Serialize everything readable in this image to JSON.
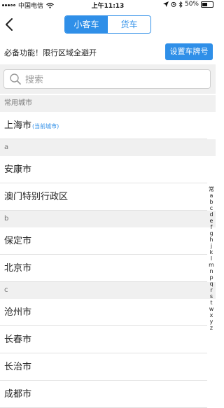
{
  "status": {
    "carrier": "中国电信",
    "time": "上午11:13",
    "battery": "50%",
    "battery_level": 0.5
  },
  "nav": {
    "tabs": [
      "小客车",
      "货车"
    ],
    "active_tab": 0
  },
  "promo": {
    "text": "必备功能！限行区域全避开",
    "button": "设置车牌号"
  },
  "search": {
    "placeholder": "搜索",
    "value": ""
  },
  "sections": [
    {
      "header": "常用城市",
      "cities": [
        {
          "name": "上海市",
          "tag": "(当前城市)"
        }
      ]
    },
    {
      "header": "a",
      "cities": [
        {
          "name": "安康市"
        },
        {
          "name": "澳门特别行政区"
        }
      ]
    },
    {
      "header": "b",
      "cities": [
        {
          "name": "保定市"
        },
        {
          "name": "北京市"
        }
      ]
    },
    {
      "header": "c",
      "cities": [
        {
          "name": "沧州市"
        },
        {
          "name": "长春市"
        },
        {
          "name": "长治市"
        },
        {
          "name": "成都市"
        }
      ]
    }
  ],
  "index": [
    "常",
    "a",
    "b",
    "c",
    "d",
    "e",
    "f",
    "g",
    "h",
    "j",
    "k",
    "l",
    "m",
    "n",
    "p",
    "q",
    "r",
    "s",
    "t",
    "w",
    "x",
    "y",
    "z"
  ],
  "colors": {
    "accent": "#2f8fe8",
    "section_bg": "#f0f0f0"
  }
}
